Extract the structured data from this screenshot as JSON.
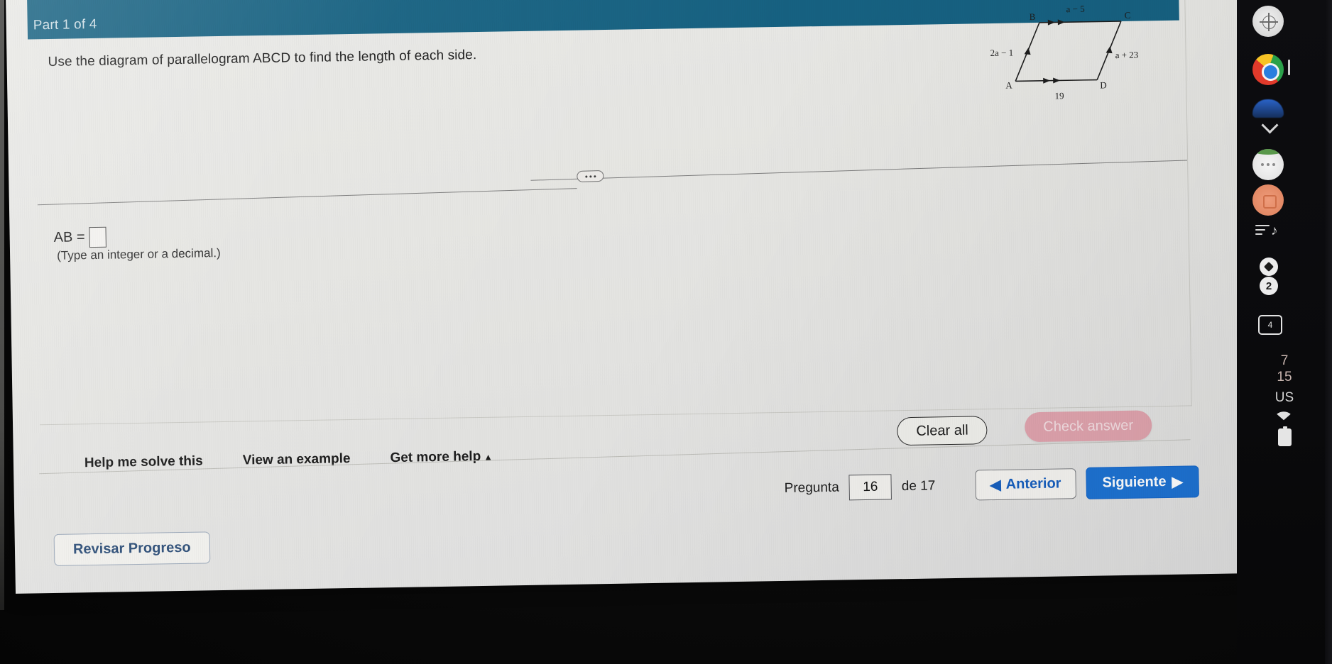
{
  "header": {
    "part_label": "Part 1 of 4",
    "band_color": "#166181"
  },
  "question": {
    "stem": "Use the diagram of parallelogram ABCD to find the length of each side.",
    "answer_prefix": "AB =",
    "answer_value": "",
    "hint": "(Type an integer or a decimal.)"
  },
  "figure": {
    "type": "parallelogram",
    "vertices": [
      "B",
      "C",
      "A",
      "D"
    ],
    "labels": {
      "top_side": "a − 5",
      "bottom_side": "19",
      "left_side": "2a − 1",
      "right_side": "a + 23",
      "vertex_b": "B",
      "vertex_c": "C",
      "vertex_a": "A",
      "vertex_d": "D"
    }
  },
  "divider": {
    "ellipsis": "•••"
  },
  "actions": {
    "clear_all": "Clear all",
    "check_answer": "Check answer",
    "check_answer_color": "#dfa3ad"
  },
  "help": {
    "help_me_solve": "Help me solve this",
    "view_example": "View an example",
    "get_more_help": "Get more help",
    "get_more_help_caret": "▲"
  },
  "nav": {
    "question_label": "Pregunta",
    "question_number": "16",
    "of_label": "de 17",
    "previous": "Anterior",
    "previous_caret": "◀",
    "next": "Siguiente",
    "next_caret": "▶",
    "next_color": "#1d72d2",
    "review_progress": "Revisar Progreso"
  },
  "dock": {
    "icons": [
      "compass-icon",
      "chrome-icon",
      "blue-app-icon",
      "chevron-down-icon",
      "white-app-icon",
      "orange-app-icon",
      "music-queue-icon",
      "diamond-badge-icon",
      "notification-count-icon",
      "tab-count-icon"
    ],
    "notification_count": "2",
    "tab_count": "4"
  },
  "status": {
    "value_top": "7",
    "value_bottom": "15",
    "locale": "US",
    "wifi_icon": "wifi-icon",
    "battery_icon": "battery-icon"
  }
}
